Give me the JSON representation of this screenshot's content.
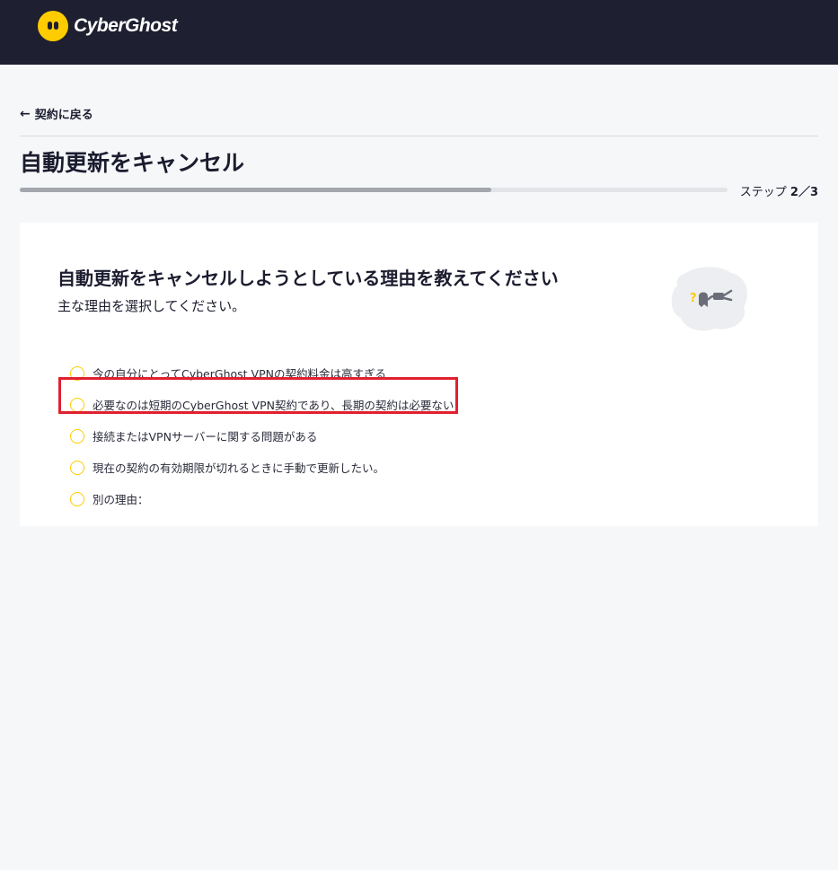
{
  "header": {
    "logo_text": "CyberGhost",
    "logo_icon": "cyberghost-ghost-icon"
  },
  "nav": {
    "back_label": "契約に戻る",
    "back_icon": "arrow-left-icon"
  },
  "page": {
    "title": "自動更新をキャンセル",
    "step_prefix": "ステップ",
    "step_value": "2／3",
    "progress": 0.6667
  },
  "card": {
    "title": "自動更新をキャンセルしようとしている理由を教えてください",
    "subtitle": "主な理由を選択してください。",
    "illustration": "ghost-unplugged-illustration",
    "options": [
      "今の自分にとってCyberGhost VPNの契約料金は高すぎる",
      "必要なのは短期のCyberGhost VPN契約であり、長期の契約は必要ない",
      "接続またはVPNサーバーに関する問題がある",
      "現在の契約の有効期限が切れるときに手動で更新したい。",
      "別の理由："
    ]
  },
  "colors": {
    "header_bg": "#1e1f30",
    "accent": "#ffcc00",
    "highlight": "#e0202f",
    "page_bg": "#f6f7f9"
  }
}
